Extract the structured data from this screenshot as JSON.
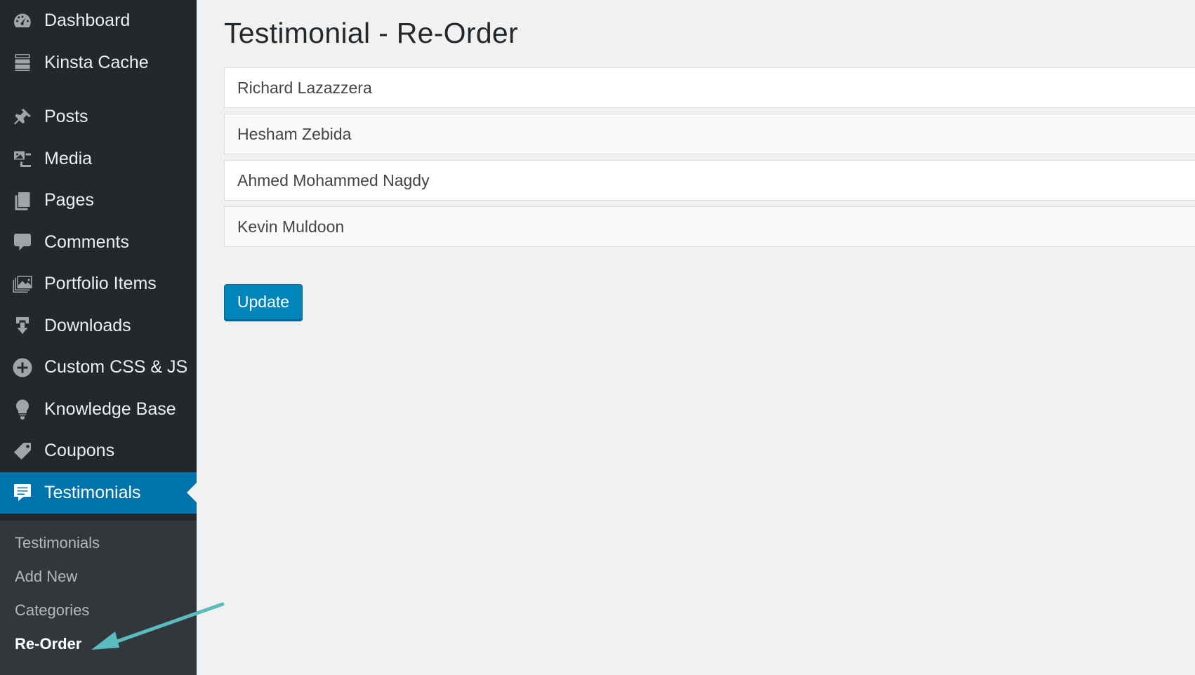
{
  "sidebar": {
    "items": [
      {
        "label": "Dashboard",
        "icon": "dashboard-icon"
      },
      {
        "label": "Kinsta Cache",
        "icon": "server-icon"
      },
      {
        "label": "Posts",
        "icon": "pushpin-icon"
      },
      {
        "label": "Media",
        "icon": "media-icon"
      },
      {
        "label": "Pages",
        "icon": "pages-icon"
      },
      {
        "label": "Comments",
        "icon": "comment-icon"
      },
      {
        "label": "Portfolio Items",
        "icon": "portfolio-icon"
      },
      {
        "label": "Downloads",
        "icon": "download-icon"
      },
      {
        "label": "Custom CSS & JS",
        "icon": "plus-circle-icon"
      },
      {
        "label": "Knowledge Base",
        "icon": "lightbulb-icon"
      },
      {
        "label": "Coupons",
        "icon": "tag-icon"
      },
      {
        "label": "Testimonials",
        "icon": "testimonial-icon"
      }
    ],
    "submenu": [
      {
        "label": "Testimonials"
      },
      {
        "label": "Add New"
      },
      {
        "label": "Categories"
      },
      {
        "label": "Re-Order"
      }
    ]
  },
  "main": {
    "title": "Testimonial - Re-Order",
    "items": [
      "Richard Lazazzera",
      "Hesham Zebida",
      "Ahmed Mohammed Nagdy",
      "Kevin Muldoon"
    ],
    "update_label": "Update"
  },
  "colors": {
    "sidebar_bg": "#23282d",
    "active_bg": "#0073aa",
    "button_bg": "#0085ba",
    "arrow": "#5bbcc0"
  }
}
